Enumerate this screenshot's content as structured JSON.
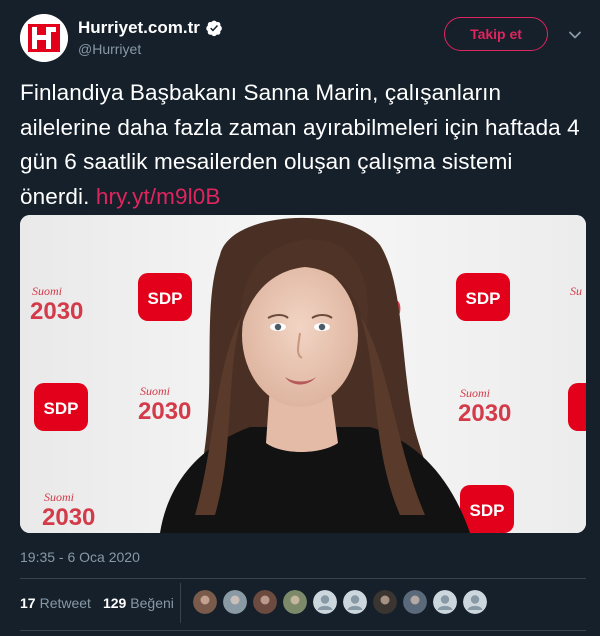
{
  "account": {
    "display_name": "Hurriyet.com.tr",
    "handle": "@Hurriyet",
    "logo_text": "H",
    "verified_icon": "verified-badge-icon",
    "follow_label": "Takip et",
    "menu_icon": "chevron-down-icon",
    "accent_color": "#e0245e"
  },
  "tweet": {
    "text": "Finlandiya Başbakanı Sanna Marin, çalışanların ailelerine daha fazla zaman ayırabilmeleri için haftada 4 gün 6 saatlik mesailerden oluşan çalışma sistemi önerdi.",
    "link": "hry.yt/m9l0B",
    "timestamp": "19:35 - 6 Oca 2020"
  },
  "photo": {
    "backdrop_logo": "SDP",
    "backdrop_logo_color": "#e2001a",
    "backdrop_text": "Suomi 2030"
  },
  "stats": {
    "retweets": "17",
    "retweets_label": "Retweet",
    "likes": "129",
    "likes_label": "Beğeni"
  },
  "liked_by": [
    {
      "color": "#7a5a4a"
    },
    {
      "color": "#8a9aa4"
    },
    {
      "color": "#6b4a40"
    },
    {
      "color": "#7d8a6a"
    },
    {
      "color": "#ccd6dd"
    },
    {
      "color": "#ccd6dd"
    },
    {
      "color": "#3a3530"
    },
    {
      "color": "#5a6a7a"
    },
    {
      "color": "#ccd6dd"
    },
    {
      "color": "#ccd6dd"
    }
  ],
  "theme": {
    "background": "#15202b",
    "muted_text": "#8899a6",
    "border": "#38444d"
  }
}
